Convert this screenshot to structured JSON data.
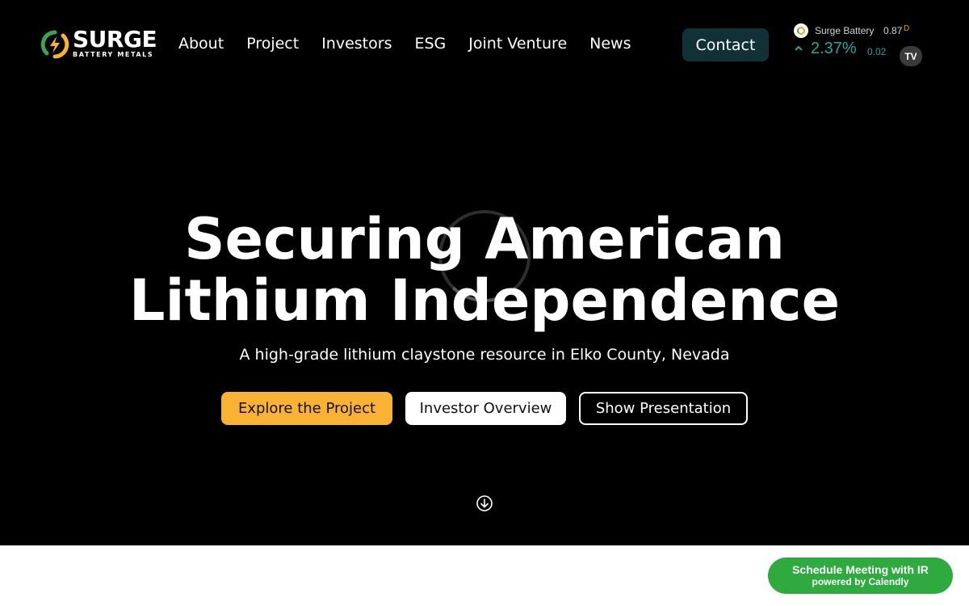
{
  "header": {
    "logo": {
      "word": "SURGE",
      "sub": "BATTERY METALS",
      "icon": "lightning-bolt-icon",
      "colors": {
        "green": "#3aa655",
        "yellow": "#f9b233"
      }
    },
    "nav": [
      {
        "label": "About"
      },
      {
        "label": "Project"
      },
      {
        "label": "Investors"
      },
      {
        "label": "ESG"
      },
      {
        "label": "Joint Venture"
      },
      {
        "label": "News"
      }
    ],
    "contact_label": "Contact"
  },
  "ticker": {
    "name": "Surge Battery",
    "price": "0.87",
    "interval": "D",
    "change_percent": "2.37%",
    "change_value": "0.02",
    "badge": "TV",
    "colors": {
      "up": "#26a69a",
      "interval": "#f7931a"
    }
  },
  "hero": {
    "title_line1": "Securing American",
    "title_line2": "Lithium Independence",
    "subtitle": "A high-grade lithium claystone resource in Elko County, Nevada",
    "buttons": {
      "explore": "Explore the Project",
      "investor": "Investor Overview",
      "presentation": "Show Presentation"
    },
    "colors": {
      "accent": "#f9b233",
      "contact_bg": "#103236"
    }
  },
  "calendly": {
    "main": "Schedule Meeting with IR",
    "sub": "powered by Calendly",
    "color": "#2eaa3f"
  }
}
